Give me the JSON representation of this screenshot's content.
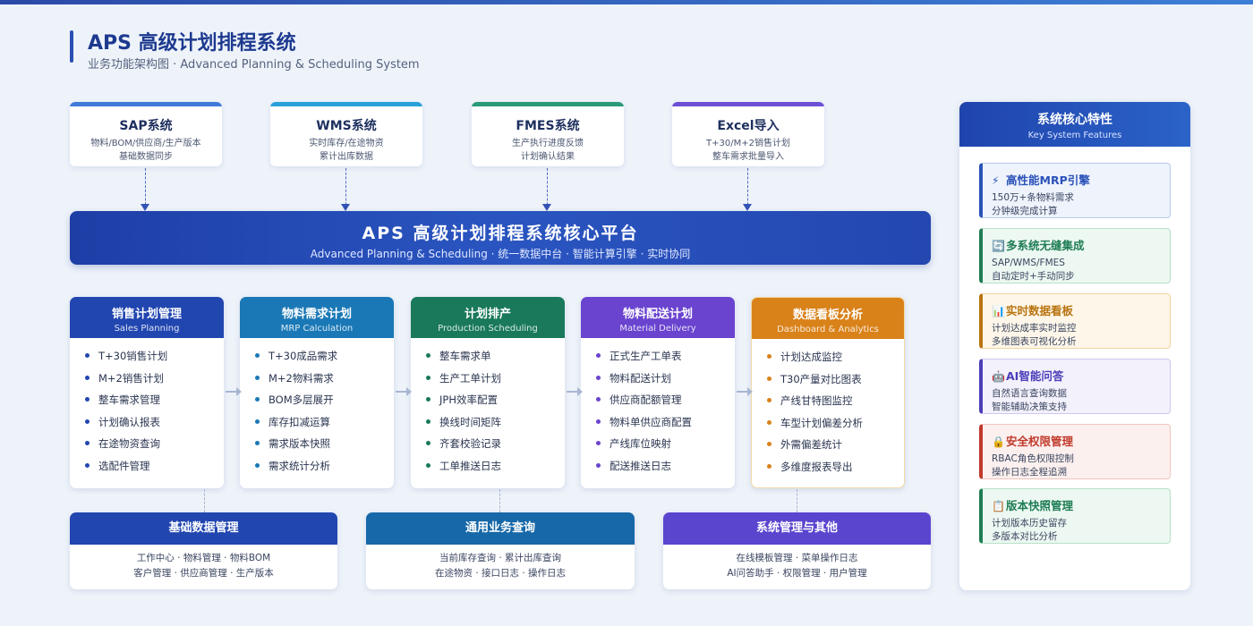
{
  "header": {
    "title": "APS 高级计划排程系统",
    "subtitle": "业务功能架构图 · Advanced Planning & Scheduling System"
  },
  "sources": [
    {
      "name": "SAP系统",
      "line1": "物料/BOM/供应商/生产版本",
      "line2": "基础数据同步",
      "color": "#3f7ad8"
    },
    {
      "name": "WMS系统",
      "line1": "实时库存/在途物资",
      "line2": "累计出库数据",
      "color": "#2aa0d8"
    },
    {
      "name": "FMES系统",
      "line1": "生产执行进度反馈",
      "line2": "计划确认结果",
      "color": "#2a9a78"
    },
    {
      "name": "Excel导入",
      "line1": "T+30/M+2销售计划",
      "line2": "整车需求批量导入",
      "color": "#6d4fd6"
    }
  ],
  "core": {
    "title": "APS 高级计划排程系统核心平台",
    "subtitle": "Advanced Planning & Scheduling · 统一数据中台 · 智能计算引擎 · 实时协同"
  },
  "modules": [
    {
      "title": "销售计划管理",
      "en": "Sales Planning",
      "color": "#2146b0",
      "items": [
        "T+30销售计划",
        "M+2销售计划",
        "整车需求管理",
        "计划确认报表",
        "在途物资查询",
        "选配件管理"
      ]
    },
    {
      "title": "物料需求计划",
      "en": "MRP Calculation",
      "color": "#1a78b6",
      "items": [
        "T+30成品需求",
        "M+2物料需求",
        "BOM多层展开",
        "库存扣减运算",
        "需求版本快照",
        "需求统计分析"
      ]
    },
    {
      "title": "计划排产",
      "en": "Production Scheduling",
      "color": "#19795a",
      "items": [
        "整车需求单",
        "生产工单计划",
        "JPH效率配置",
        "换线时间矩阵",
        "齐套校验记录",
        "工单推送日志"
      ]
    },
    {
      "title": "物料配送计划",
      "en": "Material Delivery",
      "color": "#6a43cf",
      "items": [
        "正式生产工单表",
        "物料配送计划",
        "供应商配额管理",
        "物料单供应商配置",
        "产线库位映射",
        "配送推送日志"
      ]
    },
    {
      "title": "数据看板分析",
      "en": "Dashboard & Analytics",
      "color": "#d9821a",
      "items": [
        "计划达成监控",
        "T30产量对比图表",
        "产线甘特图监控",
        "车型计划偏差分析",
        "外需偏差统计",
        "多维度报表导出"
      ]
    }
  ],
  "groups": [
    {
      "title": "基础数据管理",
      "line1": "工作中心 · 物料管理 · 物料BOM",
      "line2": "客户管理 · 供应商管理 · 生产版本",
      "color": "#2146b0"
    },
    {
      "title": "通用业务查询",
      "line1": "当前库存查询 · 累计出库查询",
      "line2": "在途物资 · 接口日志 · 操作日志",
      "color": "#1768a8"
    },
    {
      "title": "系统管理与其他",
      "line1": "在线模板管理 · 菜单操作日志",
      "line2": "AI问答助手 · 权限管理 · 用户管理",
      "color": "#5a45cf"
    }
  ],
  "features_panel": {
    "title": "系统核心特性",
    "subtitle": "Key System Features",
    "items": [
      {
        "icon": "⚡",
        "icon_name": "lightning-icon",
        "title": "高性能MRP引擎",
        "line1": "150万+条物料需求",
        "line2": "分钟级完成计算",
        "color": "#2a52b8",
        "bg": "#eef3fc",
        "border": "#b8c9ec"
      },
      {
        "icon": "🔄",
        "icon_name": "sync-icon",
        "title": "多系统无缝集成",
        "line1": "SAP/WMS/FMES",
        "line2": "自动定时+手动同步",
        "color": "#1f7d55",
        "bg": "#edf8f2",
        "border": "#b6e0c8"
      },
      {
        "icon": "📊",
        "icon_name": "chart-icon",
        "title": "实时数据看板",
        "line1": "计划达成率实时监控",
        "line2": "多维图表可视化分析",
        "color": "#b8740f",
        "bg": "#fdf6e9",
        "border": "#f0d59e"
      },
      {
        "icon": "🤖",
        "icon_name": "robot-icon",
        "title": "AI智能问答",
        "line1": "自然语言查询数据",
        "line2": "智能辅助决策支持",
        "color": "#4b3db8",
        "bg": "#f3f1fc",
        "border": "#cfc8ef"
      },
      {
        "icon": "🔒",
        "icon_name": "lock-icon",
        "title": "安全权限管理",
        "line1": "RBAC角色权限控制",
        "line2": "操作日志全程追溯",
        "color": "#c0392b",
        "bg": "#fcf0ee",
        "border": "#efc4bd"
      },
      {
        "icon": "📋",
        "icon_name": "clipboard-icon",
        "title": "版本快照管理",
        "line1": "计划版本历史留存",
        "line2": "多版本对比分析",
        "color": "#1f7d55",
        "bg": "#edf8f2",
        "border": "#b6e0c8"
      }
    ]
  }
}
